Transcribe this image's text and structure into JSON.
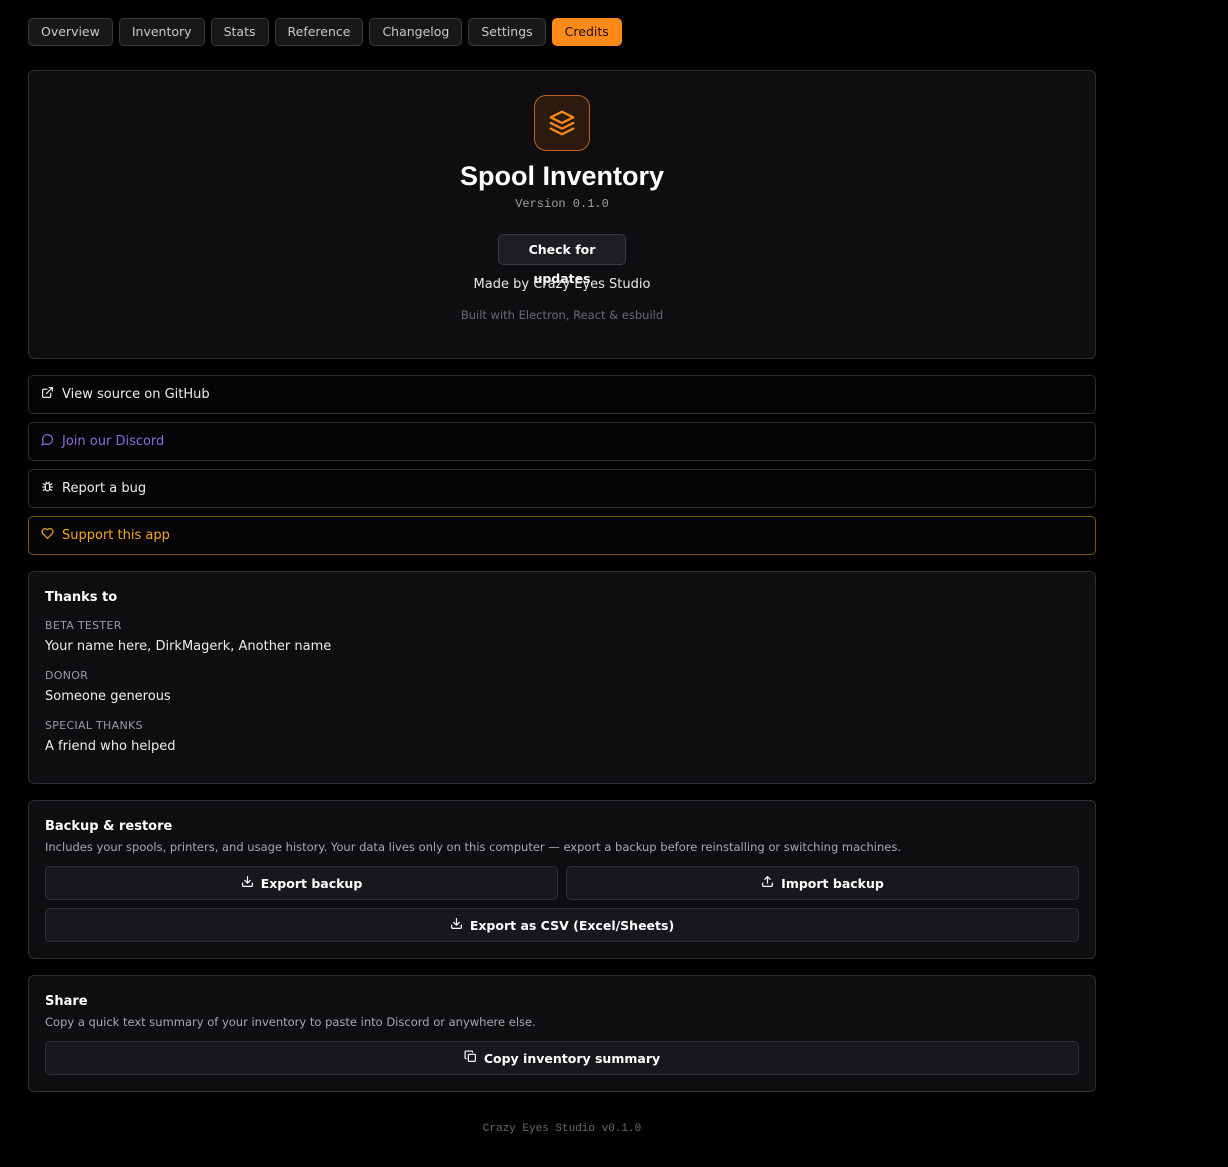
{
  "tabs": [
    {
      "label": "Overview",
      "active": false
    },
    {
      "label": "Inventory",
      "active": false
    },
    {
      "label": "Stats",
      "active": false
    },
    {
      "label": "Reference",
      "active": false
    },
    {
      "label": "Changelog",
      "active": false
    },
    {
      "label": "Settings",
      "active": false
    },
    {
      "label": "Credits",
      "active": true
    }
  ],
  "about": {
    "app_icon": "layers-icon",
    "title": "Spool Inventory",
    "version": "Version 0.1.0",
    "check_updates_label": "Check for updates",
    "made_by": "Made by Crazy Eyes Studio",
    "built_with": "Built with Electron, React & esbuild"
  },
  "links": {
    "github": {
      "label": "View source on GitHub",
      "icon": "external-link-icon"
    },
    "discord": {
      "label": "Join our Discord",
      "icon": "chat-bubble-icon"
    },
    "bug": {
      "label": "Report a bug",
      "icon": "bug-icon"
    },
    "support": {
      "label": "Support this app",
      "icon": "heart-icon"
    }
  },
  "thanks": {
    "title": "Thanks to",
    "groups": [
      {
        "role": "BETA TESTER",
        "names": "Your name here, DirkMagerk, Another name"
      },
      {
        "role": "DONOR",
        "names": "Someone generous"
      },
      {
        "role": "SPECIAL THANKS",
        "names": "A friend who helped"
      }
    ]
  },
  "backup": {
    "title": "Backup & restore",
    "description": "Includes your spools, printers, and usage history. Your data lives only on this computer — export a backup before reinstalling or switching machines.",
    "export_label": "Export backup",
    "import_label": "Import backup",
    "csv_label": "Export as CSV (Excel/Sheets)"
  },
  "share": {
    "title": "Share",
    "description": "Copy a quick text summary of your inventory to paste into Discord or anywhere else.",
    "copy_label": "Copy inventory summary"
  },
  "footer": "Crazy Eyes Studio v0.1.0",
  "colors": {
    "accent": "#ff8a1a",
    "discord": "#8b6bd9",
    "support": "#f4a62a",
    "background": "#000000",
    "card": "#0e0e11"
  }
}
